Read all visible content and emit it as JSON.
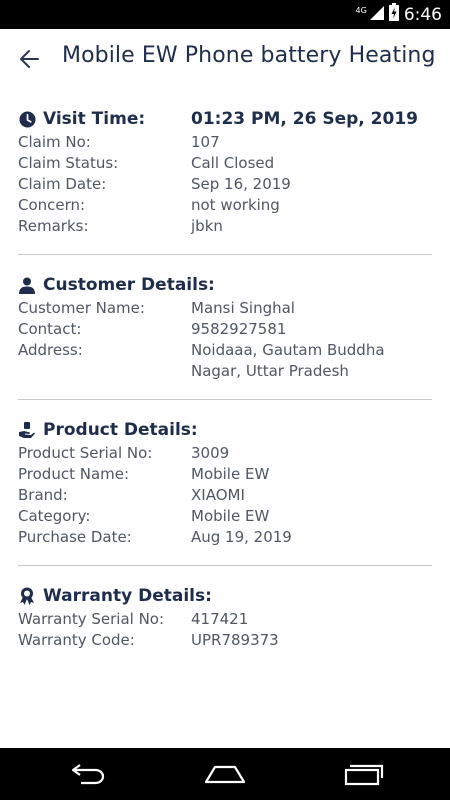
{
  "status_bar": {
    "network": "4G",
    "time": "6:46"
  },
  "header": {
    "title": "Mobile EW Phone battery Heating"
  },
  "visit": {
    "heading": "Visit Time:",
    "value": "01:23 PM, 26 Sep, 2019",
    "rows": [
      {
        "label": "Claim No:",
        "value": "107"
      },
      {
        "label": "Claim Status:",
        "value": "Call Closed"
      },
      {
        "label": "Claim Date:",
        "value": "Sep 16, 2019"
      },
      {
        "label": "Concern:",
        "value": "not working"
      },
      {
        "label": "Remarks:",
        "value": "jbkn"
      }
    ]
  },
  "customer": {
    "heading": "Customer Details:",
    "rows": [
      {
        "label": "Customer Name:",
        "value": "Mansi Singhal"
      },
      {
        "label": "Contact:",
        "value": "9582927581"
      },
      {
        "label": "Address:",
        "value": "Noidaaa, Gautam Buddha Nagar, Uttar Pradesh"
      }
    ]
  },
  "product": {
    "heading": "Product Details:",
    "rows": [
      {
        "label": "Product Serial No:",
        "value": "3009"
      },
      {
        "label": "Product Name:",
        "value": "Mobile EW"
      },
      {
        "label": "Brand:",
        "value": "XIAOMI"
      },
      {
        "label": "Category:",
        "value": "Mobile EW"
      },
      {
        "label": "Purchase Date:",
        "value": "Aug 19, 2019"
      }
    ]
  },
  "warranty": {
    "heading": "Warranty Details:",
    "rows": [
      {
        "label": "Warranty Serial No:",
        "value": "417421"
      },
      {
        "label": "Warranty Code:",
        "value": "UPR789373"
      }
    ]
  },
  "icons": {
    "back": "arrow-left-icon",
    "visit": "clock-icon",
    "customer": "person-icon",
    "product": "hand-holding-icon",
    "warranty": "award-ribbon-icon"
  },
  "colors": {
    "heading": "#1f2d4d",
    "text": "#505763",
    "divider": "#c9c9c9"
  }
}
